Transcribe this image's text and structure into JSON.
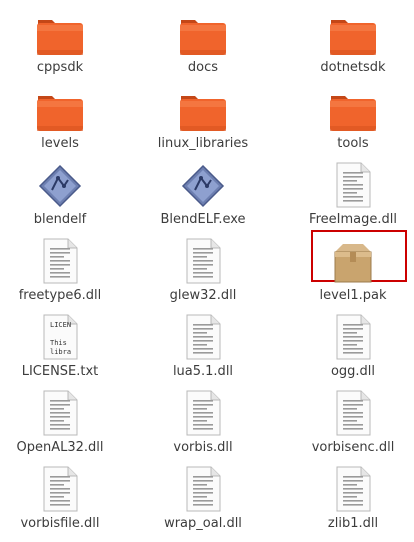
{
  "files": [
    {
      "name": "cppsdk",
      "icon": "folder-icon"
    },
    {
      "name": "docs",
      "icon": "folder-icon"
    },
    {
      "name": "dotnetsdk",
      "icon": "folder-icon"
    },
    {
      "name": "levels",
      "icon": "folder-icon"
    },
    {
      "name": "linux_libraries",
      "icon": "folder-icon"
    },
    {
      "name": "tools",
      "icon": "folder-icon"
    },
    {
      "name": "blendelf",
      "icon": "executable-icon"
    },
    {
      "name": "BlendELF.exe",
      "icon": "executable-icon"
    },
    {
      "name": "FreeImage.dll",
      "icon": "document-icon"
    },
    {
      "name": "freetype6.dll",
      "icon": "document-icon"
    },
    {
      "name": "glew32.dll",
      "icon": "document-icon"
    },
    {
      "name": "level1.pak",
      "icon": "package-icon",
      "selected": true
    },
    {
      "name": "LICENSE.txt",
      "icon": "text-file-icon",
      "preview_lines": [
        "LICEN",
        "",
        "This",
        "libra"
      ]
    },
    {
      "name": "lua5.1.dll",
      "icon": "document-icon"
    },
    {
      "name": "ogg.dll",
      "icon": "document-icon"
    },
    {
      "name": "OpenAL32.dll",
      "icon": "document-icon"
    },
    {
      "name": "vorbis.dll",
      "icon": "document-icon"
    },
    {
      "name": "vorbisenc.dll",
      "icon": "document-icon"
    },
    {
      "name": "vorbisfile.dll",
      "icon": "document-icon"
    },
    {
      "name": "wrap_oal.dll",
      "icon": "document-icon"
    },
    {
      "name": "zlib1.dll",
      "icon": "document-icon"
    }
  ],
  "colors": {
    "folder": "#f0642c",
    "selection_border": "#cc0000"
  }
}
